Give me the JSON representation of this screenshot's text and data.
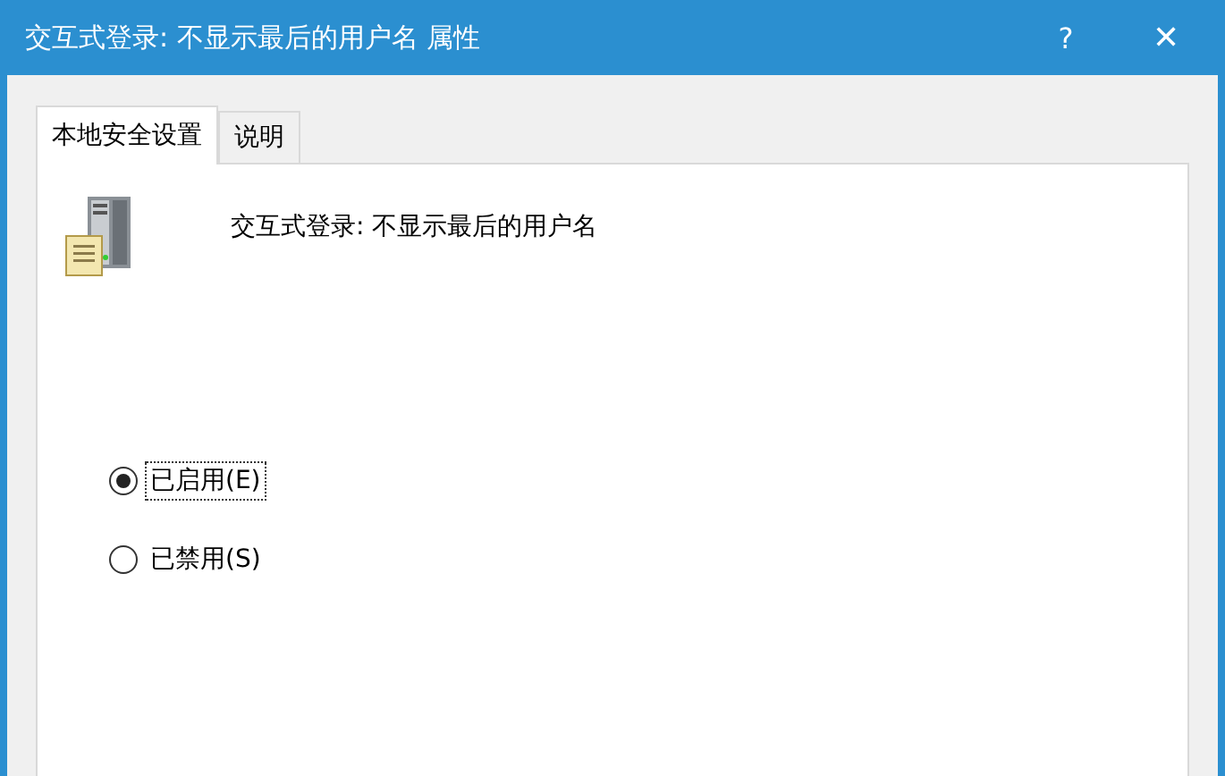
{
  "window": {
    "title": "交互式登录: 不显示最后的用户名 属性",
    "help": "?",
    "close": "✕"
  },
  "tabs": [
    {
      "label": "本地安全设置",
      "selected": true
    },
    {
      "label": "说明",
      "selected": false
    }
  ],
  "policy": {
    "name": "交互式登录: 不显示最后的用户名"
  },
  "options": [
    {
      "label": "已启用(E)",
      "selected": true
    },
    {
      "label": "已禁用(S)",
      "selected": false
    }
  ]
}
